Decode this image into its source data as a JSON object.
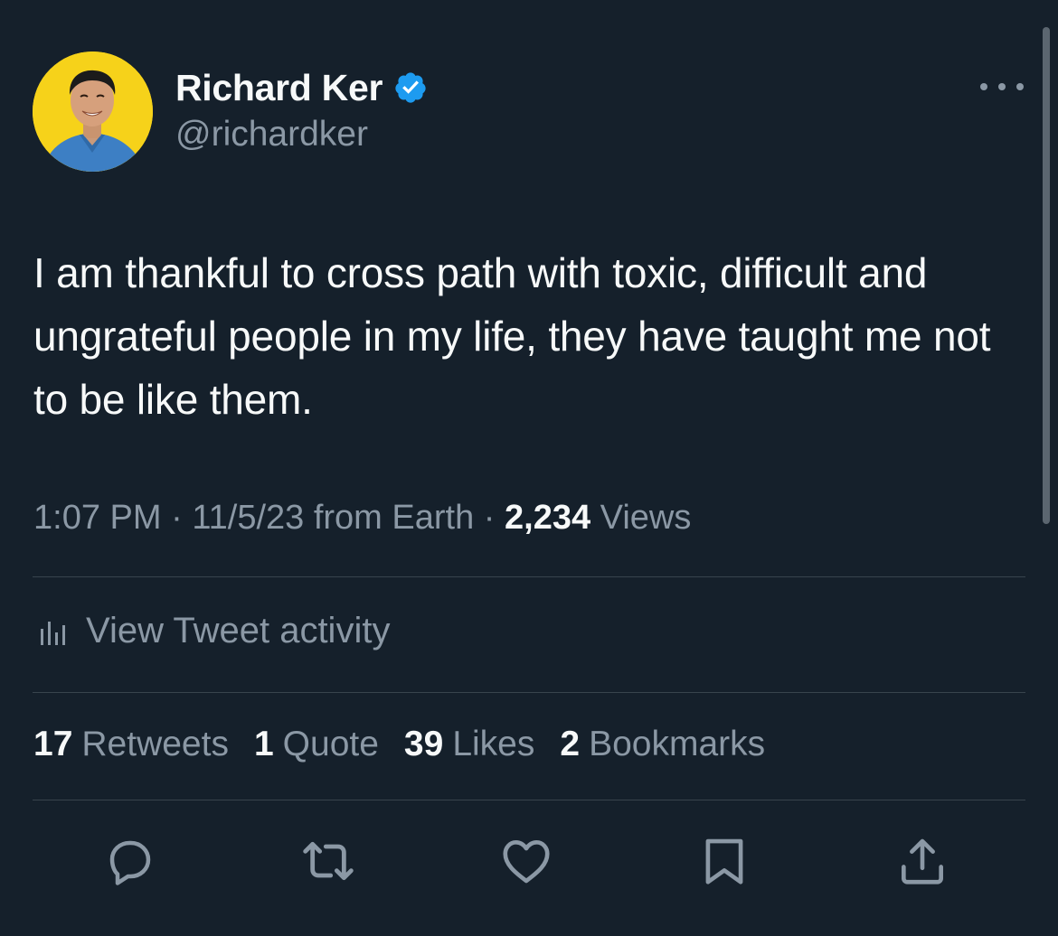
{
  "author": {
    "display_name": "Richard Ker",
    "handle": "@richardker",
    "verified": true,
    "avatar_background": "#f6d21a"
  },
  "tweet": {
    "text": "I am thankful to cross path with toxic, difficult and ungrateful people in my life, they have taught me not to be like them.",
    "time": "1:07 PM",
    "separator": "·",
    "date_source": "11/5/23 from Earth",
    "views_count": "2,234",
    "views_label": "Views"
  },
  "activity": {
    "label": "View Tweet activity",
    "icon": "bar-chart-icon"
  },
  "stats": [
    {
      "count": "17",
      "label": "Retweets"
    },
    {
      "count": "1",
      "label": "Quote"
    },
    {
      "count": "39",
      "label": "Likes"
    },
    {
      "count": "2",
      "label": "Bookmarks"
    }
  ],
  "actions": [
    "reply-icon",
    "retweet-icon",
    "like-icon",
    "bookmark-icon",
    "share-icon"
  ],
  "colors": {
    "background": "#15202b",
    "primary_text": "#f7f9f9",
    "secondary_text": "#8b98a5",
    "divider": "#38444d",
    "verified_blue": "#1d9bf0"
  }
}
